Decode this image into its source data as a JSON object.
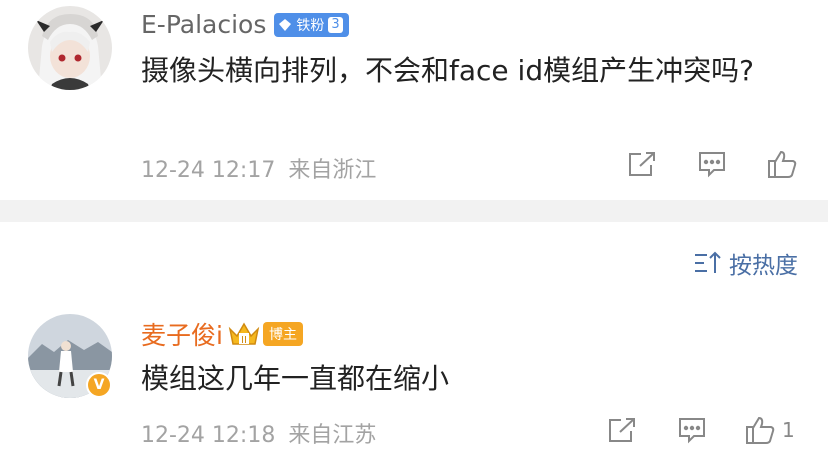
{
  "comments": [
    {
      "username": "E-Palacios",
      "badge_label": "铁粉",
      "badge_level": "3",
      "text": "摄像头横向排列，不会和face id模组产生冲突吗?",
      "time": "12-24 12:17",
      "location": "来自浙江",
      "like_count": ""
    },
    {
      "username": "麦子俊i",
      "badge_label": "博主",
      "verified_mark": "V",
      "text": "模组这几年一直都在缩小",
      "time": "12-24 12:18",
      "location": "来自江苏",
      "like_count": "1"
    }
  ],
  "sort": {
    "label": "按热度"
  },
  "colors": {
    "link_blue": "#4a6fa5",
    "orange_name": "#e86b1f",
    "fan_badge": "#4f8fe8",
    "blogger_badge": "#f5a623"
  },
  "icons": [
    "share-icon",
    "comment-icon",
    "like-icon",
    "sort-icon",
    "crown-icon",
    "diamond-icon"
  ]
}
